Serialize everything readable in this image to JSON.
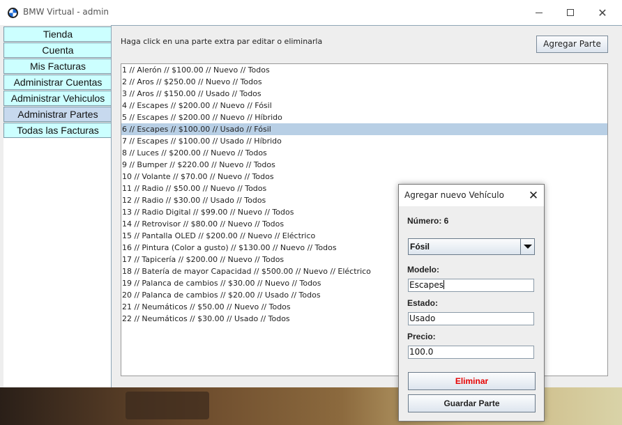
{
  "window": {
    "title": "BMW Virtual - admin"
  },
  "sidebar": {
    "items": [
      {
        "label": "Tienda"
      },
      {
        "label": "Cuenta"
      },
      {
        "label": "Mis Facturas"
      },
      {
        "label": "Administrar Cuentas"
      },
      {
        "label": "Administrar Vehiculos"
      },
      {
        "label": "Administrar Partes",
        "active": true
      },
      {
        "label": "Todas las Facturas"
      }
    ]
  },
  "main": {
    "instruction": "Haga click en una parte extra par editar o eliminarla",
    "add_button": "Agregar Parte",
    "parts": [
      "1 // Alerón // $100.00 // Nuevo // Todos",
      "2 // Aros // $250.00 // Nuevo // Todos",
      "3 // Aros // $150.00 // Usado // Todos",
      "4 // Escapes // $200.00 // Nuevo // Fósil",
      "5 // Escapes // $200.00 // Nuevo // Híbrido",
      "6 // Escapes // $100.00 // Usado // Fósil",
      "7 // Escapes // $100.00 // Usado // Híbrido",
      "8 // Luces // $200.00 // Nuevo // Todos",
      "9 // Bumper // $220.00 // Nuevo // Todos",
      "10 // Volante // $70.00 // Nuevo // Todos",
      "11 // Radio // $50.00 // Nuevo // Todos",
      "12 // Radio // $30.00 // Usado // Todos",
      "13 // Radio Digital // $99.00 // Nuevo // Todos",
      "14 // Retrovisor // $80.00 // Nuevo // Todos",
      "15 // Pantalla OLED // $200.00 // Nuevo // Eléctrico",
      "16 // Pintura (Color a gusto) // $130.00 // Nuevo // Todos",
      "17 // Tapicería // $200.00 // Nuevo // Todos",
      "18 // Batería de mayor Capacidad // $500.00 // Nuevo // Eléctrico",
      "19 // Palanca de cambios // $30.00 // Nuevo // Todos",
      "20 // Palanca de cambios // $20.00 // Usado // Todos",
      "21 // Neumáticos // $50.00 // Nuevo // Todos",
      "22 // Neumáticos // $30.00 // Usado // Todos"
    ],
    "selected_index": 5
  },
  "dialog": {
    "title": "Agregar nuevo Vehículo",
    "numero_label": "Número: 6",
    "tipo_selected": "Fósil",
    "modelo_label": "Modelo:",
    "modelo_value": "Escapes",
    "estado_label": "Estado:",
    "estado_value": "Usado",
    "precio_label": "Precio:",
    "precio_value": "100.0",
    "delete_button": "Eliminar",
    "save_button": "Guardar Parte"
  },
  "colors": {
    "tab_bg": "#ccffff",
    "tab_active_bg": "#c7d9ee",
    "selection_bg": "#b8cfe5",
    "danger": "#e60000"
  }
}
